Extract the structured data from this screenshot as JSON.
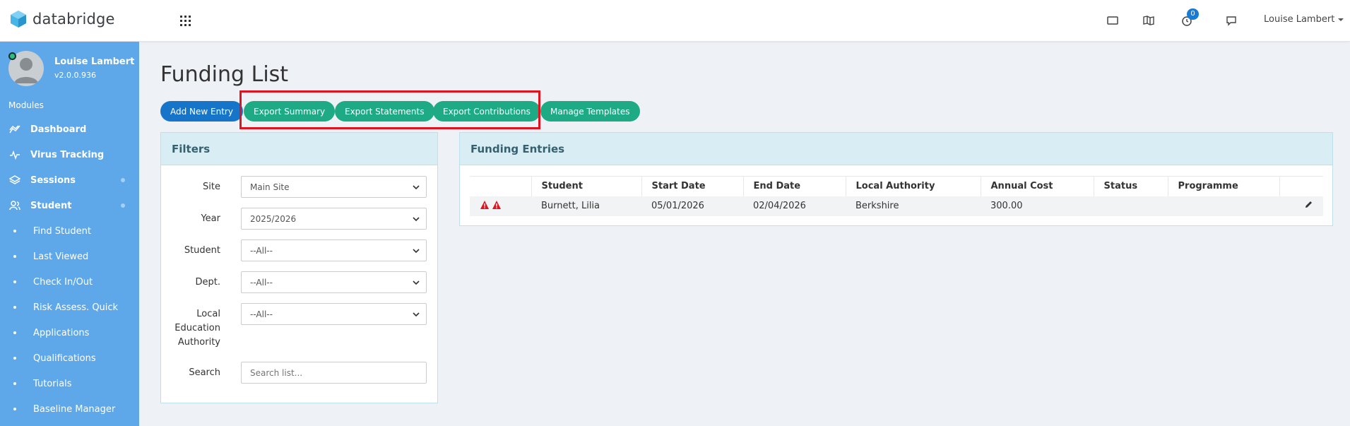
{
  "app": {
    "name": "databridge"
  },
  "topbar": {
    "notification_count": "0",
    "user_name": "Louise Lambert"
  },
  "sidebar": {
    "profile_name": "Louise Lambert",
    "version": "v2.0.0.936",
    "modules_label": "Modules",
    "items": [
      {
        "label": "Dashboard",
        "icon": "chart-line-icon",
        "type": "main"
      },
      {
        "label": "Virus Tracking",
        "icon": "pulse-icon",
        "type": "main"
      },
      {
        "label": "Sessions",
        "icon": "layers-icon",
        "type": "main"
      },
      {
        "label": "Student",
        "icon": "users-icon",
        "type": "main"
      },
      {
        "label": "Find Student",
        "type": "sub"
      },
      {
        "label": "Last Viewed",
        "type": "sub"
      },
      {
        "label": "Check In/Out",
        "type": "sub"
      },
      {
        "label": "Risk Assess. Quick",
        "type": "sub"
      },
      {
        "label": "Applications",
        "type": "sub"
      },
      {
        "label": "Qualifications",
        "type": "sub"
      },
      {
        "label": "Tutorials",
        "type": "sub"
      },
      {
        "label": "Baseline Manager",
        "type": "sub"
      }
    ]
  },
  "page": {
    "title": "Funding List",
    "buttons": {
      "add_new_entry": "Add New Entry",
      "export_summary": "Export Summary",
      "export_statements": "Export Statements",
      "export_contributions": "Export Contributions",
      "manage_templates": "Manage Templates"
    }
  },
  "filters": {
    "title": "Filters",
    "site_label": "Site",
    "site_value": "Main Site",
    "year_label": "Year",
    "year_value": "2025/2026",
    "student_label": "Student",
    "student_value": "--All--",
    "dept_label": "Dept.",
    "dept_value": "--All--",
    "lea_label_1": "Local",
    "lea_label_2": "Education",
    "lea_label_3": "Authority",
    "lea_value": "--All--",
    "search_label": "Search",
    "search_placeholder": "Search list..."
  },
  "entries": {
    "title": "Funding Entries",
    "columns": [
      "",
      "Student",
      "Start Date",
      "End Date",
      "Local Authority",
      "Annual Cost",
      "Status",
      "Programme",
      ""
    ],
    "rows": [
      {
        "student": "Burnett, Lilia",
        "start_date": "05/01/2026",
        "end_date": "02/04/2026",
        "local_authority": "Berkshire",
        "annual_cost": "300.00",
        "status": "",
        "programme": ""
      }
    ]
  },
  "colors": {
    "sidebar": "#5ea8ea",
    "primary_blue": "#1775c9",
    "green": "#1daa84",
    "highlight_red": "#e0131f",
    "warning_red": "#e0131f"
  }
}
